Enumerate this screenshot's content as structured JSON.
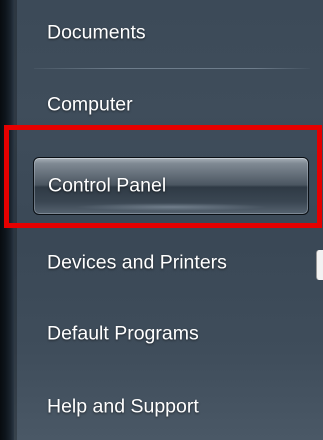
{
  "start_menu": {
    "items": [
      {
        "label": "Documents"
      },
      {
        "label": "Computer"
      },
      {
        "label": "Control Panel",
        "state": "hovered"
      },
      {
        "label": "Devices and Printers"
      },
      {
        "label": "Default Programs"
      },
      {
        "label": "Help and Support"
      }
    ]
  },
  "annotation": {
    "highlight_color": "#e60000",
    "highlighted_item": "Control Panel"
  }
}
